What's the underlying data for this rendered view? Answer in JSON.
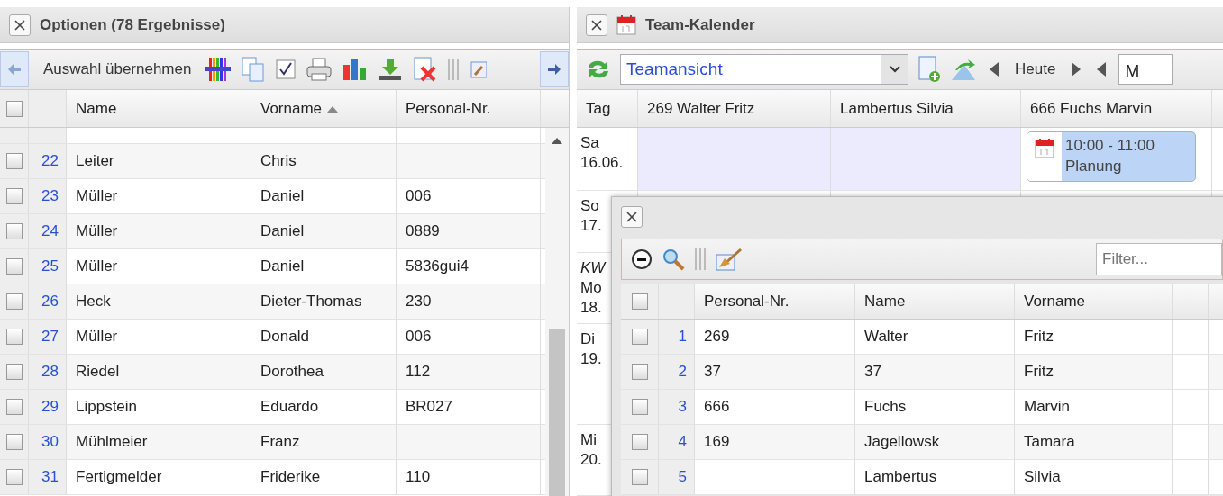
{
  "left_panel": {
    "title": "Optionen (78 Ergebnisse)",
    "toolbar": {
      "action": "Auswahl übernehmen"
    },
    "table": {
      "select_all": {
        "checked": false
      },
      "columns": [
        {
          "label": "Name",
          "sorted": false
        },
        {
          "label": "Vorname",
          "sorted": true
        },
        {
          "label": "Personal-Nr.",
          "sorted": false
        }
      ],
      "rows": [
        {
          "number": "22",
          "checked": false,
          "name": "Leiter",
          "vorname": "Chris"
        },
        {
          "number": "23",
          "checked": false,
          "name": "Müller",
          "vorname": "Daniel",
          "personal_nr": "006"
        },
        {
          "number": "24",
          "checked": false,
          "name": "Müller",
          "vorname": "Daniel",
          "personal_nr": "0889"
        },
        {
          "number": "25",
          "checked": false,
          "name": "Müller",
          "vorname": "Daniel",
          "personal_nr": "5836gui4"
        },
        {
          "number": "26",
          "checked": false,
          "name": "Heck",
          "vorname": "Dieter-Thomas",
          "personal_nr": "230"
        },
        {
          "number": "27",
          "checked": false,
          "name": "Müller",
          "vorname": "Donald",
          "personal_nr": "006"
        },
        {
          "number": "28",
          "checked": false,
          "name": "Riedel",
          "vorname": "Dorothea",
          "personal_nr": "112"
        },
        {
          "number": "29",
          "checked": false,
          "name": "Lippstein",
          "vorname": "Eduardo",
          "personal_nr": "BR027"
        },
        {
          "number": "30",
          "checked": false,
          "name": "Mühlmeier",
          "vorname": "Franz"
        },
        {
          "number": "31",
          "checked": false,
          "name": "Fertigmelder",
          "vorname": "Friderike",
          "personal_nr": "110"
        }
      ]
    }
  },
  "calendar_panel": {
    "title": "Team-Kalender",
    "toolbar": {
      "view": "Teamansicht",
      "today": "Heute",
      "date_field": "M"
    },
    "columns": [
      "Tag",
      "269 Walter Fritz",
      "Lambertus Silvia",
      "666 Fuchs Marvin"
    ],
    "days": [
      {
        "weekday": "Sa",
        "date": "16.06.",
        "cells": [
          {
            "shaded": true
          },
          {
            "shaded": true
          },
          {
            "shaded": false,
            "event": {
              "time": "10:00 - 11:00",
              "title": "Planung"
            }
          }
        ]
      },
      {
        "weekday": "So",
        "date": "17."
      },
      {
        "week": "KW",
        "weekday": "Mo",
        "date": "18."
      },
      {
        "weekday": "Di",
        "date": "19."
      },
      {
        "weekday": "Mi",
        "date": "20."
      }
    ]
  },
  "dialog": {
    "filter": {
      "placeholder": "Filter..."
    },
    "select_all": {
      "checked": false
    },
    "columns": [
      "Personal-Nr.",
      "Name",
      "Vorname"
    ],
    "rows": [
      {
        "number": "1",
        "checked": false,
        "personal_nr": "269",
        "name": "Walter",
        "vorname": "Fritz"
      },
      {
        "number": "2",
        "checked": false,
        "personal_nr": "37",
        "name": "37",
        "vorname": "Fritz"
      },
      {
        "number": "3",
        "checked": false,
        "personal_nr": "666",
        "name": "Fuchs",
        "vorname": "Marvin"
      },
      {
        "number": "4",
        "checked": false,
        "personal_nr": "169",
        "name": "Jagellowsk",
        "vorname": "Tamara"
      },
      {
        "number": "5",
        "checked": false,
        "name": "Lambertus",
        "vorname": "Silvia"
      }
    ]
  }
}
